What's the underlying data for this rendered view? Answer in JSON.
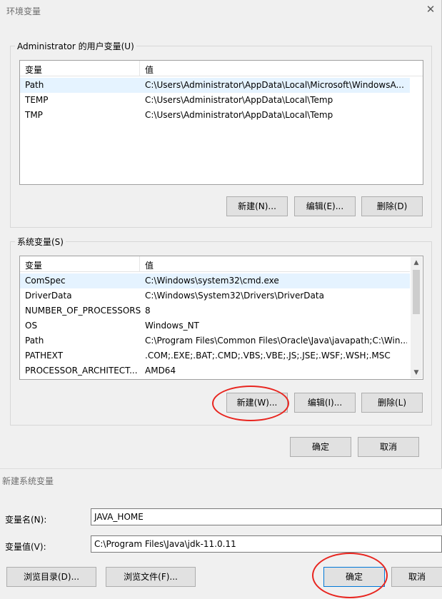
{
  "env_dialog": {
    "title": "环境变量",
    "close_glyph": "✕",
    "user_group": {
      "legend": "Administrator 的用户变量(U)",
      "columns": [
        "变量",
        "值"
      ],
      "rows": [
        [
          "Path",
          "C:\\Users\\Administrator\\AppData\\Local\\Microsoft\\WindowsA..."
        ],
        [
          "TEMP",
          "C:\\Users\\Administrator\\AppData\\Local\\Temp"
        ],
        [
          "TMP",
          "C:\\Users\\Administrator\\AppData\\Local\\Temp"
        ]
      ],
      "buttons": {
        "new": "新建(N)...",
        "edit": "编辑(E)...",
        "delete": "删除(D)"
      }
    },
    "system_group": {
      "legend": "系统变量(S)",
      "columns": [
        "变量",
        "值"
      ],
      "rows": [
        [
          "ComSpec",
          "C:\\Windows\\system32\\cmd.exe"
        ],
        [
          "DriverData",
          "C:\\Windows\\System32\\Drivers\\DriverData"
        ],
        [
          "NUMBER_OF_PROCESSORS",
          "8"
        ],
        [
          "OS",
          "Windows_NT"
        ],
        [
          "Path",
          "C:\\Program Files\\Common Files\\Oracle\\Java\\javapath;C:\\Win..."
        ],
        [
          "PATHEXT",
          ".COM;.EXE;.BAT;.CMD;.VBS;.VBE;.JS;.JSE;.WSF;.WSH;.MSC"
        ],
        [
          "PROCESSOR_ARCHITECT...",
          "AMD64"
        ]
      ],
      "buttons": {
        "new": "新建(W)...",
        "edit": "编辑(I)...",
        "delete": "删除(L)"
      }
    },
    "ok": "确定",
    "cancel": "取消"
  },
  "new_var_dialog": {
    "title": "新建系统变量",
    "name_label": "变量名(N):",
    "name_value": "JAVA_HOME",
    "value_label": "变量值(V):",
    "value_value": "C:\\Program Files\\Java\\jdk-11.0.11",
    "browse_dir": "浏览目录(D)...",
    "browse_file": "浏览文件(F)...",
    "ok": "确定",
    "cancel": "取消"
  },
  "colors": {
    "annotation_ring": "#e8251f",
    "selection": "#e5f3ff",
    "default_button_border": "#0078d7"
  }
}
